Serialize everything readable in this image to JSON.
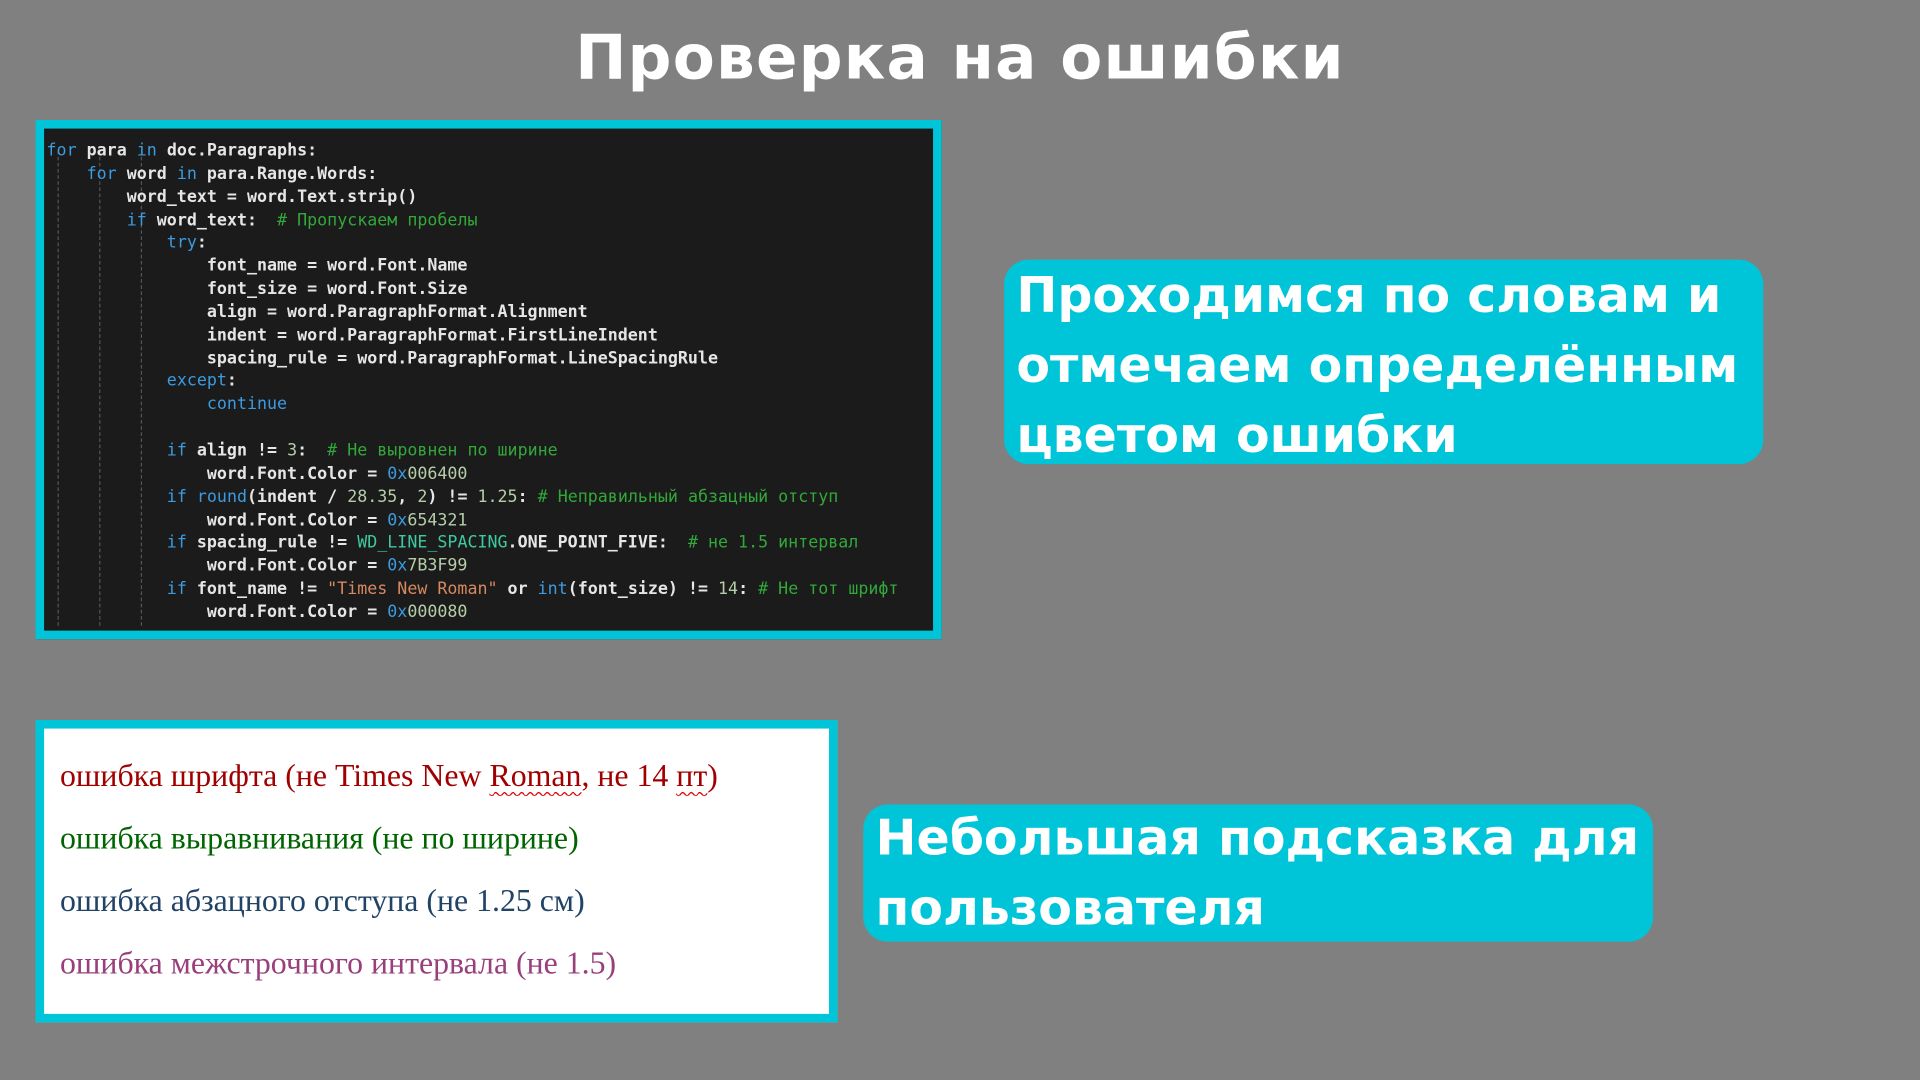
{
  "title": "Проверка на ошибки",
  "code_lines": [
    [
      [
        "for",
        "kw"
      ],
      [
        " para ",
        "id"
      ],
      [
        "in",
        "kw"
      ],
      [
        " doc.Paragraphs:",
        "id"
      ]
    ],
    [
      [
        "    ",
        "id"
      ],
      [
        "for",
        "kw"
      ],
      [
        " word ",
        "id"
      ],
      [
        "in",
        "kw"
      ],
      [
        " para.Range.Words:",
        "id"
      ]
    ],
    [
      [
        "        word_text = word.Text.strip()",
        "id"
      ]
    ],
    [
      [
        "        ",
        "id"
      ],
      [
        "if",
        "kw"
      ],
      [
        " word_text:  ",
        "id"
      ],
      [
        "# Пропускаем пробелы",
        "cm"
      ]
    ],
    [
      [
        "            ",
        "id"
      ],
      [
        "try",
        "kw"
      ],
      [
        ":",
        "id"
      ]
    ],
    [
      [
        "                font_name = word.Font.Name",
        "id"
      ]
    ],
    [
      [
        "                font_size = word.Font.Size",
        "id"
      ]
    ],
    [
      [
        "                align = word.ParagraphFormat.Alignment",
        "id"
      ]
    ],
    [
      [
        "                indent = word.ParagraphFormat.FirstLineIndent",
        "id"
      ]
    ],
    [
      [
        "                spacing_rule = word.ParagraphFormat.LineSpacingRule",
        "id"
      ]
    ],
    [
      [
        "            ",
        "id"
      ],
      [
        "except",
        "kw"
      ],
      [
        ":",
        "id"
      ]
    ],
    [
      [
        "                ",
        "id"
      ],
      [
        "continue",
        "kw"
      ]
    ],
    [
      [
        "",
        "id"
      ]
    ],
    [
      [
        "            ",
        "id"
      ],
      [
        "if",
        "kw"
      ],
      [
        " align != ",
        "id"
      ],
      [
        "3",
        "num"
      ],
      [
        ":  ",
        "id"
      ],
      [
        "# Не выровнен по ширине",
        "cm"
      ]
    ],
    [
      [
        "                word.Font.Color = ",
        "id"
      ],
      [
        "0x",
        "hex"
      ],
      [
        "006400",
        "num"
      ]
    ],
    [
      [
        "            ",
        "id"
      ],
      [
        "if",
        "kw"
      ],
      [
        " ",
        "id"
      ],
      [
        "round",
        "fn"
      ],
      [
        "(indent / ",
        "id"
      ],
      [
        "28.35",
        "num"
      ],
      [
        ", ",
        "id"
      ],
      [
        "2",
        "num"
      ],
      [
        ") != ",
        "id"
      ],
      [
        "1.25",
        "num"
      ],
      [
        ": ",
        "id"
      ],
      [
        "# Неправильный абзацный отступ",
        "cm"
      ]
    ],
    [
      [
        "                word.Font.Color = ",
        "id"
      ],
      [
        "0x",
        "hex"
      ],
      [
        "654321",
        "num"
      ]
    ],
    [
      [
        "            ",
        "id"
      ],
      [
        "if",
        "kw"
      ],
      [
        " spacing_rule != ",
        "id"
      ],
      [
        "WD_LINE_SPACING",
        "cls"
      ],
      [
        ".ONE_POINT_FIVE:  ",
        "id"
      ],
      [
        "# не 1.5 интервал",
        "cm"
      ]
    ],
    [
      [
        "                word.Font.Color = ",
        "id"
      ],
      [
        "0x",
        "hex"
      ],
      [
        "7B3F99",
        "num"
      ]
    ],
    [
      [
        "            ",
        "id"
      ],
      [
        "if",
        "kw"
      ],
      [
        " font_name != ",
        "id"
      ],
      [
        "\"Times New Roman\"",
        "str"
      ],
      [
        " or ",
        "id"
      ],
      [
        "int",
        "fn"
      ],
      [
        "(font_size) != ",
        "id"
      ],
      [
        "14",
        "num"
      ],
      [
        ": ",
        "id"
      ],
      [
        "# Не тот шрифт",
        "cm"
      ]
    ],
    [
      [
        "                word.Font.Color = ",
        "id"
      ],
      [
        "0x",
        "hex"
      ],
      [
        "000080",
        "num"
      ]
    ]
  ],
  "callouts": {
    "words": "Проходимся по словам и отмечаем определённым цветом ошибки",
    "hint": "Небольшая подсказка для пользователя"
  },
  "legend": [
    {
      "text_before": "ошибка шрифта (не Times New ",
      "wavy": "Roman",
      "text_mid": ", не 14 ",
      "wavy2": "пт",
      "text_after": ")",
      "color": "#a00000"
    },
    {
      "text": "ошибка выравнивания (не по ширине)",
      "color": "#006400"
    },
    {
      "text": "ошибка абзацного отступа (не 1.25 см)",
      "color": "#214365"
    },
    {
      "text": "ошибка межстрочного интервала (не 1.5)",
      "color": "#993f7b"
    }
  ],
  "colors": {
    "accent": "#00c4d8",
    "background": "#808080",
    "code_bg": "#1b1b1b"
  }
}
